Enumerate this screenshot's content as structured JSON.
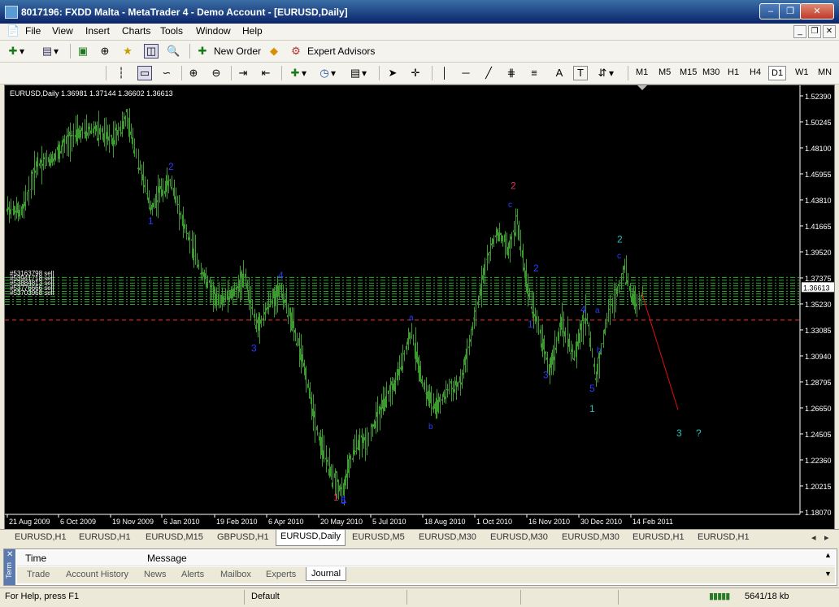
{
  "window": {
    "title": "8017196: FXDD Malta - MetaTrader 4 - Demo Account - [EURUSD,Daily]"
  },
  "menu": [
    "File",
    "View",
    "Insert",
    "Charts",
    "Tools",
    "Window",
    "Help"
  ],
  "toolbar": {
    "new_order": "New Order",
    "expert_advisors": "Expert Advisors",
    "text_tool": "A"
  },
  "timeframes": [
    "M1",
    "M5",
    "M15",
    "M30",
    "H1",
    "H4",
    "D1",
    "W1",
    "MN"
  ],
  "timeframe_active": "D1",
  "chart": {
    "info": "EURUSD,Daily  1.36981 1.37144 1.36602 1.36613",
    "price_labels": [
      "1.52390",
      "1.50245",
      "1.48100",
      "1.45955",
      "1.43810",
      "1.41665",
      "1.39520",
      "1.37375",
      "1.35230",
      "1.33085",
      "1.30940",
      "1.28795",
      "1.26650",
      "1.24505",
      "1.22360",
      "1.20215",
      "1.18070"
    ],
    "current_price": "1.36613",
    "date_labels": [
      "21 Aug 2009",
      "6 Oct 2009",
      "19 Nov 2009",
      "6 Jan 2010",
      "19 Feb 2010",
      "6 Apr 2010",
      "20 May 2010",
      "5 Jul 2010",
      "18 Aug 2010",
      "1 Oct 2010",
      "16 Nov 2010",
      "30 Dec 2010",
      "14 Feb 2011"
    ],
    "order_labels": [
      "#53163798 sell",
      "#53941718 sell",
      "#53884813 sell",
      "#53776666 sell",
      "#53703968 sell"
    ],
    "wave_labels": [
      "1",
      "2",
      "1",
      "4",
      "3",
      "1",
      "5",
      "a",
      "b",
      "2",
      "c",
      "2",
      "1",
      "3",
      "4",
      "5",
      "1",
      "a",
      "b",
      "2",
      "c",
      "3",
      "?"
    ],
    "colors": {
      "candle": "#3c9b2e",
      "order_line": "#3cc83c",
      "stop_line": "#ff2d2d",
      "wave_blue": "#2b3cff",
      "wave_cyan": "#27c0c0",
      "wave_red": "#e0306e",
      "projection": "#e01010"
    }
  },
  "chart_tabs": [
    "EURUSD,H1",
    "EURUSD,H1",
    "EURUSD,M15",
    "GBPUSD,H1",
    "EURUSD,Daily",
    "EURUSD,M5",
    "EURUSD,M30",
    "EURUSD,M30",
    "EURUSD,M30",
    "EURUSD,H1",
    "EURUSD,H1"
  ],
  "chart_tab_active": "EURUSD,Daily",
  "terminal": {
    "side_label": "Term",
    "columns": [
      "Time",
      "Message"
    ],
    "tabs": [
      "Trade",
      "Account History",
      "News",
      "Alerts",
      "Mailbox",
      "Experts",
      "Journal"
    ],
    "active_tab": "Journal"
  },
  "status": {
    "help": "For Help, press F1",
    "profile": "Default",
    "traffic": "5641/18 kb"
  }
}
